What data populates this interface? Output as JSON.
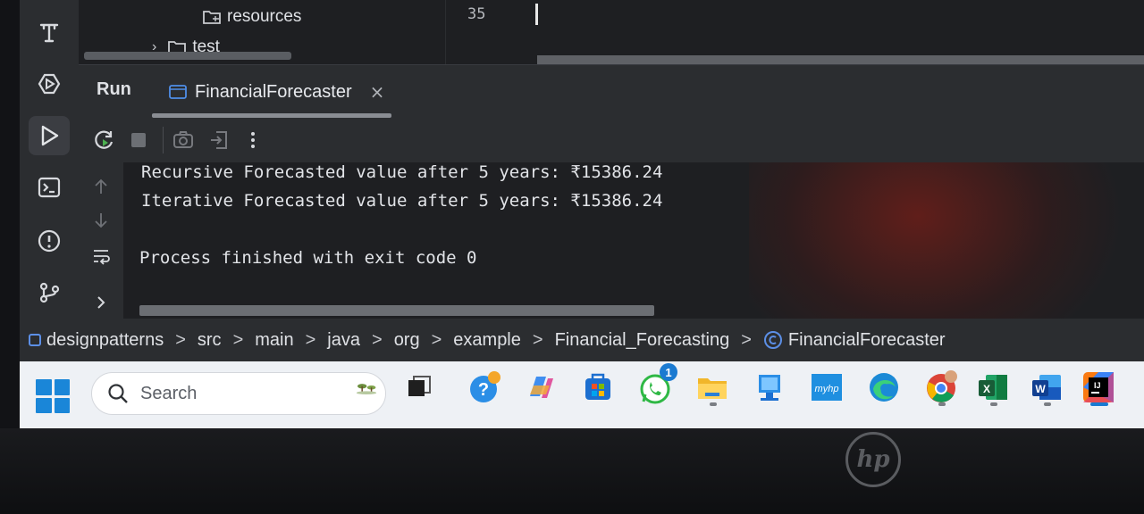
{
  "project_tree": {
    "items": [
      {
        "label": "resources",
        "icon": "folder-resources-icon"
      },
      {
        "label": "test",
        "icon": "folder-icon",
        "expand_icon": "chevron-right-icon"
      }
    ]
  },
  "editor": {
    "line_number": "35"
  },
  "run_panel": {
    "title": "Run",
    "tab": {
      "label": "FinancialForecaster",
      "close_glyph": "×"
    },
    "toolbar": [
      "rerun-icon",
      "stop-icon",
      "screenshot-icon",
      "restore-layout-icon",
      "more-options-icon"
    ]
  },
  "console": {
    "lines": [
      "Recursive Forecasted value after 5 years: ₹15386.24",
      "Iterative Forecasted value after 5 years: ₹15386.24",
      "",
      "Process finished with exit code 0"
    ]
  },
  "breadcrumb": {
    "items": [
      "designpatterns",
      "src",
      "main",
      "java",
      "org",
      "example",
      "Financial_Forecasting",
      "FinancialForecaster"
    ],
    "separator": ">"
  },
  "taskbar": {
    "search_placeholder": "Search",
    "whatsapp_badge": "1",
    "apps": [
      "task-view",
      "help",
      "copilot",
      "microsoft-store",
      "whatsapp",
      "file-explorer",
      "device-manager",
      "myhp",
      "edge",
      "chrome",
      "excel",
      "word",
      "intellij-idea"
    ],
    "myhp_label": "myhp"
  },
  "device": {
    "logo": "hp"
  },
  "colors": {
    "ide_bg": "#1e1f22",
    "panel_bg": "#2b2d30",
    "accent_blue": "#1a86d8",
    "taskbar_bg": "#eef1f5"
  }
}
